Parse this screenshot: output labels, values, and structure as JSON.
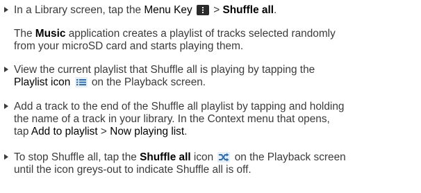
{
  "bullets": [
    {
      "t1": "In a Library screen, tap the ",
      "k1": "Menu Key",
      "icon": "menu-key-icon",
      "t2": " > ",
      "k2": "Shuffle all",
      "t3": "."
    },
    {
      "t1": "View the current playlist that Shuffle all is playing by tapping the",
      "k1": "Playlist icon",
      "icon": "playlist-icon",
      "t2": " on the Playback screen."
    },
    {
      "t1": "Add a track to the end of the Shuffle all playlist by tapping and holding",
      "t2": "the name of a track in your library. In the Context menu that opens,",
      "t3": "tap ",
      "k1": "Add to playlist",
      "t4": " > ",
      "k2": "Now playing list",
      "t5": "."
    },
    {
      "t1": "To stop Shuffle all, tap the ",
      "k1": "Shuffle all",
      "t2": " icon ",
      "icon": "shuffle-icon",
      "t3": " on the Playback screen",
      "t4": "until the icon greys-out to indicate Shuffle all is off."
    }
  ],
  "note": {
    "k1": "Music",
    "t1": " application creates a playlist of tracks selected randomly",
    "t2": "from your microSD card and starts playing them.",
    "prefix": "The "
  },
  "colors": {
    "text": "#3a3a3a",
    "emphasis": "#000000",
    "icon_blue": "#2a6fb8",
    "icon_dark": "#2b2b2b"
  }
}
